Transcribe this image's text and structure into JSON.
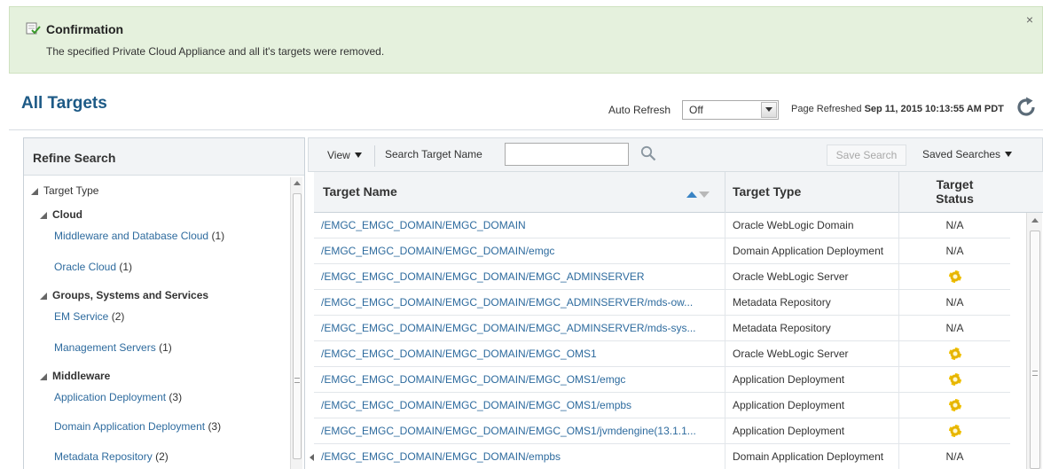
{
  "confirmation": {
    "title": "Confirmation",
    "message": "The specified Private Cloud Appliance and all it's targets were removed.",
    "close_glyph": "×",
    "icon": "check-document-icon"
  },
  "header": {
    "title": "All Targets",
    "auto_refresh_label": "Auto Refresh",
    "auto_refresh_value": "Off",
    "page_refreshed_prefix": "Page Refreshed ",
    "page_refreshed_value": "Sep 11, 2015 10:13:55 AM PDT"
  },
  "refine": {
    "title": "Refine Search",
    "target_type_label": "Target Type",
    "groups": [
      {
        "label": "Cloud",
        "items": [
          {
            "label": "Middleware and Database Cloud",
            "count": "(1)"
          },
          {
            "label": "Oracle Cloud",
            "count": "(1)"
          }
        ]
      },
      {
        "label": "Groups, Systems and Services",
        "items": [
          {
            "label": "EM Service",
            "count": "(2)"
          },
          {
            "label": "Management Servers",
            "count": "(1)"
          }
        ]
      },
      {
        "label": "Middleware",
        "items": [
          {
            "label": "Application Deployment",
            "count": "(3)"
          },
          {
            "label": "Domain Application Deployment",
            "count": "(3)"
          },
          {
            "label": "Metadata Repository",
            "count": "(2)"
          }
        ]
      }
    ]
  },
  "toolbar": {
    "view_label": "View",
    "search_label": "Search Target Name",
    "search_value": "",
    "save_search_label": "Save Search",
    "saved_searches_label": "Saved Searches"
  },
  "table": {
    "columns": [
      "Target Name",
      "Target Type",
      "Target Status"
    ],
    "status_line1": "Target",
    "status_line2": "Status",
    "rows": [
      {
        "name": "/EMGC_EMGC_DOMAIN/EMGC_DOMAIN",
        "type": "Oracle WebLogic Domain",
        "status": "N/A"
      },
      {
        "name": "/EMGC_EMGC_DOMAIN/EMGC_DOMAIN/emgc",
        "type": "Domain Application Deployment",
        "status": "N/A"
      },
      {
        "name": "/EMGC_EMGC_DOMAIN/EMGC_DOMAIN/EMGC_ADMINSERVER",
        "type": "Oracle WebLogic Server",
        "status": "gear"
      },
      {
        "name": "/EMGC_EMGC_DOMAIN/EMGC_DOMAIN/EMGC_ADMINSERVER/mds-ow...",
        "type": "Metadata Repository",
        "status": "N/A"
      },
      {
        "name": "/EMGC_EMGC_DOMAIN/EMGC_DOMAIN/EMGC_ADMINSERVER/mds-sys...",
        "type": "Metadata Repository",
        "status": "N/A"
      },
      {
        "name": "/EMGC_EMGC_DOMAIN/EMGC_DOMAIN/EMGC_OMS1",
        "type": "Oracle WebLogic Server",
        "status": "gear"
      },
      {
        "name": "/EMGC_EMGC_DOMAIN/EMGC_DOMAIN/EMGC_OMS1/emgc",
        "type": "Application Deployment",
        "status": "gear"
      },
      {
        "name": "/EMGC_EMGC_DOMAIN/EMGC_DOMAIN/EMGC_OMS1/empbs",
        "type": "Application Deployment",
        "status": "gear"
      },
      {
        "name": "/EMGC_EMGC_DOMAIN/EMGC_DOMAIN/EMGC_OMS1/jvmdengine(13.1.1...",
        "type": "Application Deployment",
        "status": "gear"
      },
      {
        "name": "/EMGC_EMGC_DOMAIN/EMGC_DOMAIN/empbs",
        "type": "Domain Application Deployment",
        "status": "N/A"
      }
    ]
  },
  "colors": {
    "banner_bg": "#e5f1dd",
    "title_blue": "#1d5a86",
    "link_blue": "#2e6b9e",
    "sort_active": "#3a84c4",
    "status_gear": "#f2c200"
  },
  "icons": {
    "refresh": "refresh-icon",
    "search": "search-icon",
    "status_pending": "gear-icon"
  }
}
